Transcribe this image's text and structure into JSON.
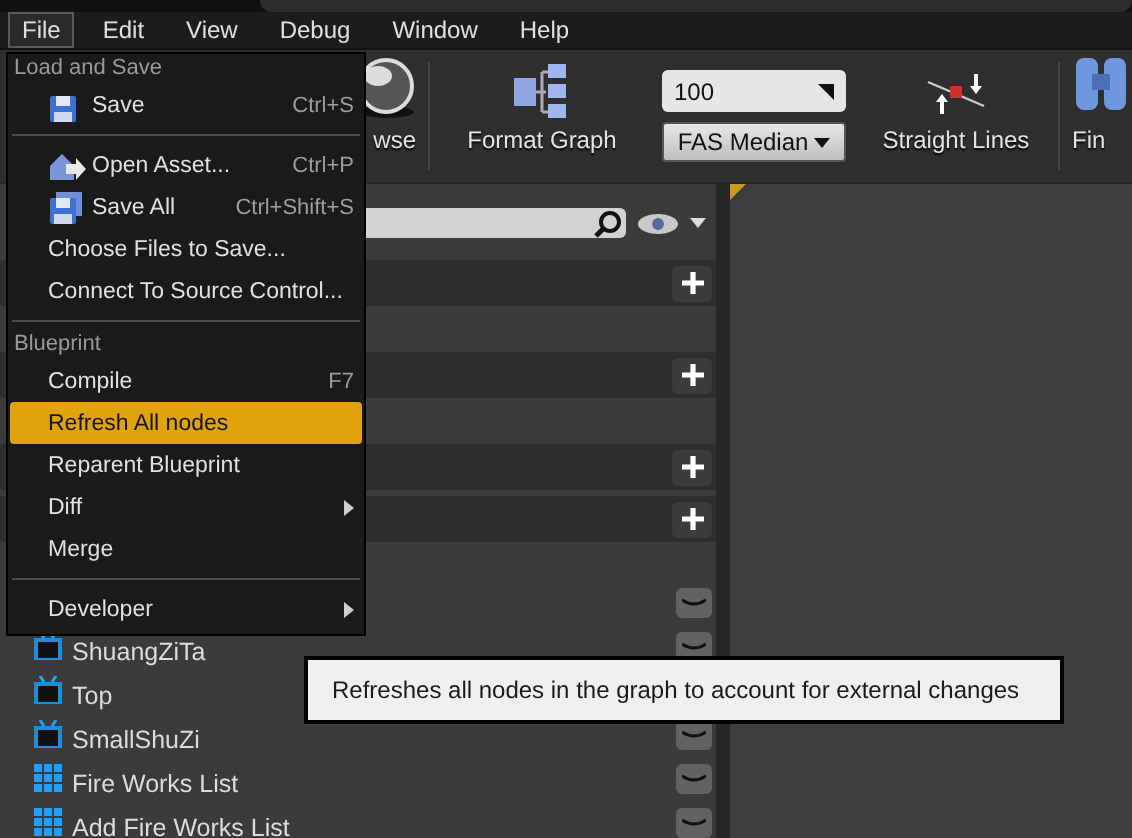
{
  "menu_bar": [
    {
      "label": "File",
      "selected": true
    },
    {
      "label": "Edit",
      "selected": false
    },
    {
      "label": "View",
      "selected": false
    },
    {
      "label": "Debug",
      "selected": false
    },
    {
      "label": "Window",
      "selected": false
    },
    {
      "label": "Help",
      "selected": false
    }
  ],
  "toolbar": [
    {
      "kind": "browse",
      "label": "wse"
    },
    {
      "kind": "format",
      "label": "Format Graph"
    },
    {
      "kind": "field",
      "value": "100",
      "dropdown": "FAS Median"
    },
    {
      "kind": "lines",
      "label": "Straight Lines"
    },
    {
      "kind": "find",
      "label": "Fin"
    }
  ],
  "variables": [
    {
      "name": "ShuangZiTa",
      "kind": "actor"
    },
    {
      "name": "Top",
      "kind": "actor"
    },
    {
      "name": "SmallShuZi",
      "kind": "actor"
    },
    {
      "name": "Fire Works List",
      "kind": "array"
    },
    {
      "name": "Add Fire Works List",
      "kind": "array"
    }
  ],
  "file_menu": [
    {
      "header": "Load and Save",
      "items": [
        {
          "label": "Save",
          "shortcut": "Ctrl+S",
          "kind": "save",
          "submenu": false,
          "selected": false
        }
      ]
    },
    {
      "items": [
        {
          "label": "Open Asset...",
          "shortcut": "Ctrl+P",
          "kind": "open",
          "submenu": false,
          "selected": false
        },
        {
          "label": "Save All",
          "shortcut": "Ctrl+Shift+S",
          "kind": "save_all",
          "submenu": false,
          "selected": false
        },
        {
          "label": "Choose Files to Save...",
          "kind": "text",
          "submenu": false,
          "selected": false
        },
        {
          "label": "Connect To Source Control...",
          "kind": "text",
          "submenu": false,
          "selected": false
        }
      ]
    },
    {
      "header": "Blueprint",
      "items": [
        {
          "label": "Compile",
          "shortcut": "F7",
          "kind": "text",
          "submenu": false,
          "selected": false
        },
        {
          "label": "Refresh All nodes",
          "kind": "text",
          "submenu": false,
          "selected": true
        },
        {
          "label": "Reparent Blueprint",
          "kind": "text",
          "submenu": false,
          "selected": false
        },
        {
          "label": "Diff",
          "kind": "text",
          "submenu": true,
          "selected": false
        },
        {
          "label": "Merge",
          "kind": "text",
          "submenu": false,
          "selected": false
        }
      ]
    },
    {
      "items": [
        {
          "label": "Developer",
          "kind": "text",
          "submenu": true,
          "selected": false
        }
      ]
    }
  ],
  "tooltip": "Refreshes all nodes in the graph to account for external changes"
}
